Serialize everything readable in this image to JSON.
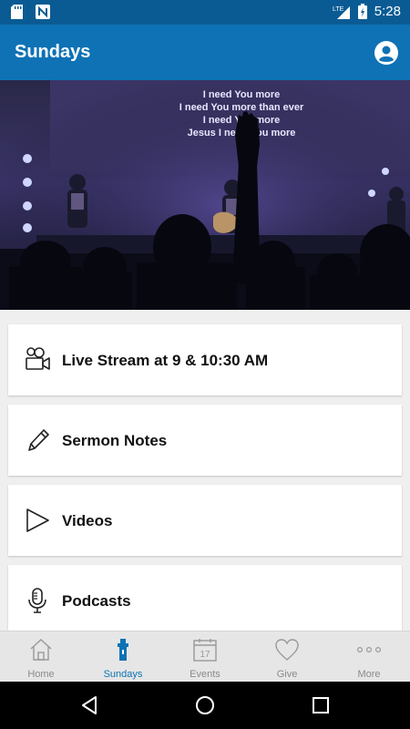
{
  "status_bar": {
    "time": "5:28",
    "network": "LTE"
  },
  "app_bar": {
    "title": "Sundays"
  },
  "hero": {
    "lyrics": [
      "I need You more",
      "I need You more than ever",
      "I need You more",
      "Jesus I need You more"
    ]
  },
  "cards": [
    {
      "label": "Live Stream at 9 & 10:30 AM",
      "icon": "video-camera-icon"
    },
    {
      "label": "Sermon Notes",
      "icon": "pencil-icon"
    },
    {
      "label": "Videos",
      "icon": "play-icon"
    },
    {
      "label": "Podcasts",
      "icon": "microphone-icon"
    }
  ],
  "tabs": [
    {
      "label": "Home",
      "icon": "home-icon"
    },
    {
      "label": "Sundays",
      "icon": "church-icon",
      "active": true
    },
    {
      "label": "Events",
      "icon": "calendar-icon",
      "badge": "17"
    },
    {
      "label": "Give",
      "icon": "heart-icon"
    },
    {
      "label": "More",
      "icon": "more-icon"
    }
  ],
  "colors": {
    "primary": "#0e72b5",
    "status": "#0a5b94",
    "tab_inactive": "#8a8a8a"
  }
}
